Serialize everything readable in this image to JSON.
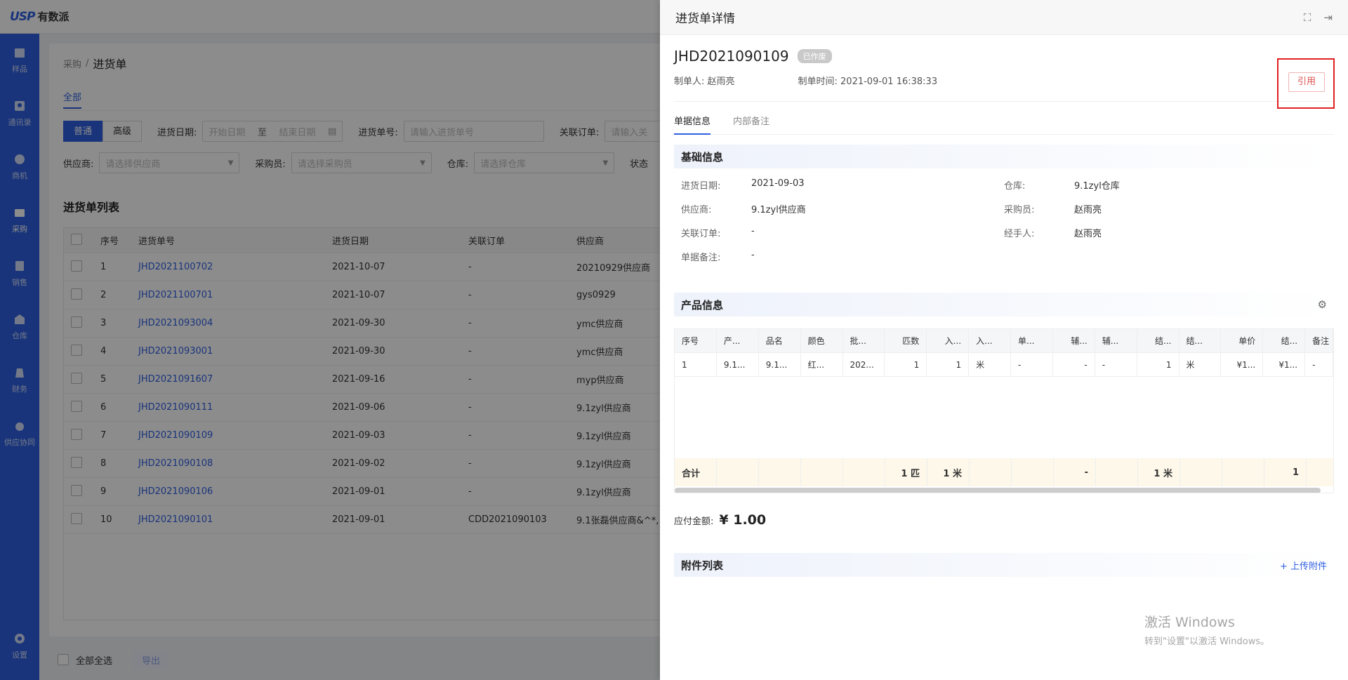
{
  "app": {
    "logo_mark": "USP",
    "logo_text": "有数派"
  },
  "sidebar": {
    "items": [
      {
        "label": "样品",
        "icon": "sample-icon"
      },
      {
        "label": "通讯录",
        "icon": "contacts-icon"
      },
      {
        "label": "商机",
        "icon": "opportunity-icon"
      },
      {
        "label": "采购",
        "icon": "purchase-icon"
      },
      {
        "label": "销售",
        "icon": "sales-icon"
      },
      {
        "label": "仓库",
        "icon": "warehouse-icon"
      },
      {
        "label": "财务",
        "icon": "finance-icon"
      },
      {
        "label": "供应协同",
        "icon": "supply-icon"
      }
    ],
    "settings_label": "设置"
  },
  "breadcrumb": {
    "parent": "采购",
    "sep": "/",
    "current": "进货单"
  },
  "main_tab": "全部",
  "filters": {
    "mode_normal": "普通",
    "mode_advanced": "高级",
    "date_label": "进货日期:",
    "date_start": "开始日期",
    "date_to": "至",
    "date_end": "结束日期",
    "order_label": "进货单号:",
    "order_placeholder": "请输入进货单号",
    "related_label": "关联订单:",
    "related_placeholder": "请输入关",
    "supplier_label": "供应商:",
    "supplier_placeholder": "请选择供应商",
    "buyer_label": "采购员:",
    "buyer_placeholder": "请选择采购员",
    "warehouse_label": "仓库:",
    "warehouse_placeholder": "请选择仓库",
    "status_label": "状态"
  },
  "list": {
    "title": "进货单列表",
    "headers": [
      "序号",
      "进货单号",
      "进货日期",
      "关联订单",
      "供应商"
    ],
    "rows": [
      [
        "1",
        "JHD2021100702",
        "2021-10-07",
        "-",
        "20210929供应商"
      ],
      [
        "2",
        "JHD2021100701",
        "2021-10-07",
        "-",
        "gys0929"
      ],
      [
        "3",
        "JHD2021093004",
        "2021-09-30",
        "-",
        "ymc供应商"
      ],
      [
        "4",
        "JHD2021093001",
        "2021-09-30",
        "-",
        "ymc供应商"
      ],
      [
        "5",
        "JHD2021091607",
        "2021-09-16",
        "-",
        "myp供应商"
      ],
      [
        "6",
        "JHD2021090111",
        "2021-09-06",
        "-",
        "9.1zyl供应商"
      ],
      [
        "7",
        "JHD2021090109",
        "2021-09-03",
        "-",
        "9.1zyl供应商"
      ],
      [
        "8",
        "JHD2021090108",
        "2021-09-02",
        "-",
        "9.1zyl供应商"
      ],
      [
        "9",
        "JHD2021090106",
        "2021-09-01",
        "-",
        "9.1zyl供应商"
      ],
      [
        "10",
        "JHD2021090101",
        "2021-09-01",
        "CDD2021090103",
        "9.1张磊供应商&^*,"
      ]
    ]
  },
  "footer": {
    "select_all": "全部全选",
    "export": "导出"
  },
  "drawer": {
    "title": "进货单详情",
    "order_no": "JHD2021090109",
    "status_badge": "已作废",
    "creator": "制单人: 赵雨亮",
    "created_time": "制单时间: 2021-09-01 16:38:33",
    "quote_button": "引用",
    "tabs": [
      "单据信息",
      "内部备注"
    ],
    "basic": {
      "title": "基础信息",
      "fields": [
        {
          "k": "进货日期:",
          "v": "2021-09-03"
        },
        {
          "k": "仓库:",
          "v": "9.1zyl仓库"
        },
        {
          "k": "供应商:",
          "v": "9.1zyl供应商"
        },
        {
          "k": "采购员:",
          "v": "赵雨亮"
        },
        {
          "k": "关联订单:",
          "v": "-"
        },
        {
          "k": "经手人:",
          "v": "赵雨亮"
        },
        {
          "k": "单据备注:",
          "v": "-"
        }
      ]
    },
    "products": {
      "title": "产品信息",
      "headers": [
        "序号",
        "产...",
        "品名",
        "颜色",
        "批...",
        "匹数",
        "入...",
        "入...",
        "单...",
        "辅...",
        "辅...",
        "结...",
        "结...",
        "单价",
        "结...",
        "备注"
      ],
      "row": [
        "1",
        "9.1...",
        "9.1...",
        "红...",
        "202...",
        "1",
        "1",
        "米",
        "-",
        "-",
        "-",
        "1",
        "米",
        "¥1...",
        "¥1...",
        "-"
      ],
      "sum": [
        "合计",
        "",
        "",
        "",
        "",
        "1 匹",
        "1 米",
        "",
        "",
        "-",
        "",
        "1 米",
        "",
        "",
        "1",
        ""
      ]
    },
    "payable_label": "应付金额:",
    "payable_amount": "¥ 1.00",
    "attachments": {
      "title": "附件列表",
      "upload": "+ 上传附件"
    }
  },
  "watermark": {
    "line1": "激活 Windows",
    "line2": "转到\"设置\"以激活 Windows。"
  }
}
